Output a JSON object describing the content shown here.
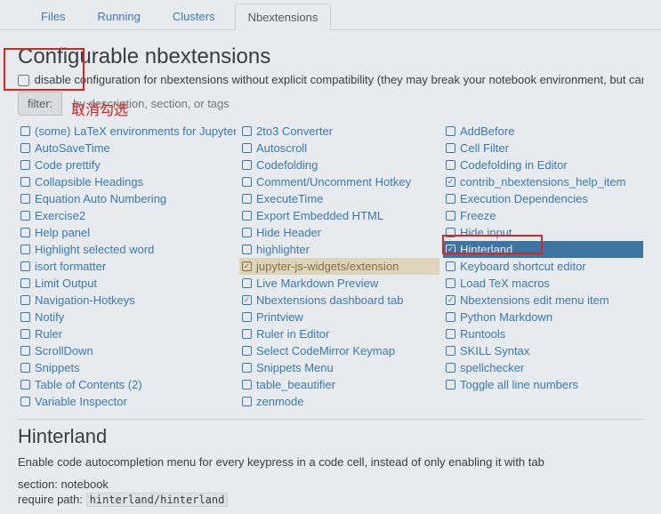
{
  "tabs": [
    {
      "label": "Files",
      "active": false
    },
    {
      "label": "Running",
      "active": false
    },
    {
      "label": "Clusters",
      "active": false
    },
    {
      "label": "Nbextensions",
      "active": true
    }
  ],
  "title": "Configurable nbextensions",
  "disable_label": "disable configuration for nbextensions without explicit compatibility (they may break your notebook environment, but can be useful to show for nbextension development)",
  "filter_label": "filter:",
  "filter_placeholder": "by description, section, or tags",
  "extensions": [
    {
      "label": "(some) LaTeX environments for Jupyter",
      "checked": false
    },
    {
      "label": "2to3 Converter",
      "checked": false
    },
    {
      "label": "AddBefore",
      "checked": false
    },
    {
      "label": "AutoSaveTime",
      "checked": false
    },
    {
      "label": "Autoscroll",
      "checked": false
    },
    {
      "label": "Cell Filter",
      "checked": false
    },
    {
      "label": "Code prettify",
      "checked": false
    },
    {
      "label": "Codefolding",
      "checked": false
    },
    {
      "label": "Codefolding in Editor",
      "checked": false
    },
    {
      "label": "Collapsible Headings",
      "checked": false
    },
    {
      "label": "Comment/Uncomment Hotkey",
      "checked": false
    },
    {
      "label": "contrib_nbextensions_help_item",
      "checked": true
    },
    {
      "label": "Equation Auto Numbering",
      "checked": false
    },
    {
      "label": "ExecuteTime",
      "checked": false
    },
    {
      "label": "Execution Dependencies",
      "checked": false
    },
    {
      "label": "Exercise2",
      "checked": false
    },
    {
      "label": "Export Embedded HTML",
      "checked": false
    },
    {
      "label": "Freeze",
      "checked": false
    },
    {
      "label": "Help panel",
      "checked": false
    },
    {
      "label": "Hide Header",
      "checked": false
    },
    {
      "label": "Hide input",
      "checked": false
    },
    {
      "label": "Highlight selected word",
      "checked": false
    },
    {
      "label": "highlighter",
      "checked": false
    },
    {
      "label": "Hinterland",
      "checked": true,
      "selected": true
    },
    {
      "label": "isort formatter",
      "checked": false
    },
    {
      "label": "jupyter-js-widgets/extension",
      "checked": true,
      "highlight": true
    },
    {
      "label": "Keyboard shortcut editor",
      "checked": false
    },
    {
      "label": "Limit Output",
      "checked": false
    },
    {
      "label": "Live Markdown Preview",
      "checked": false
    },
    {
      "label": "Load TeX macros",
      "checked": false
    },
    {
      "label": "Navigation-Hotkeys",
      "checked": false
    },
    {
      "label": "Nbextensions dashboard tab",
      "checked": true
    },
    {
      "label": "Nbextensions edit menu item",
      "checked": true
    },
    {
      "label": "Notify",
      "checked": false
    },
    {
      "label": "Printview",
      "checked": false
    },
    {
      "label": "Python Markdown",
      "checked": false
    },
    {
      "label": "Ruler",
      "checked": false
    },
    {
      "label": "Ruler in Editor",
      "checked": false
    },
    {
      "label": "Runtools",
      "checked": false
    },
    {
      "label": "ScrollDown",
      "checked": false
    },
    {
      "label": "Select CodeMirror Keymap",
      "checked": false
    },
    {
      "label": "SKILL Syntax",
      "checked": false
    },
    {
      "label": "Snippets",
      "checked": false
    },
    {
      "label": "Snippets Menu",
      "checked": false
    },
    {
      "label": "spellchecker",
      "checked": false
    },
    {
      "label": "Table of Contents (2)",
      "checked": false
    },
    {
      "label": "table_beautifier",
      "checked": false
    },
    {
      "label": "Toggle all line numbers",
      "checked": false
    },
    {
      "label": "Variable Inspector",
      "checked": false
    },
    {
      "label": "zenmode",
      "checked": false
    }
  ],
  "detail": {
    "name": "Hinterland",
    "desc": "Enable code autocompletion menu for every keypress in a code cell, instead of only enabling it with tab",
    "section_label": "section:",
    "section_value": "notebook",
    "require_label": "require path:",
    "require_value": "hinterland/hinterland"
  },
  "annotation_text": "取消勾选"
}
